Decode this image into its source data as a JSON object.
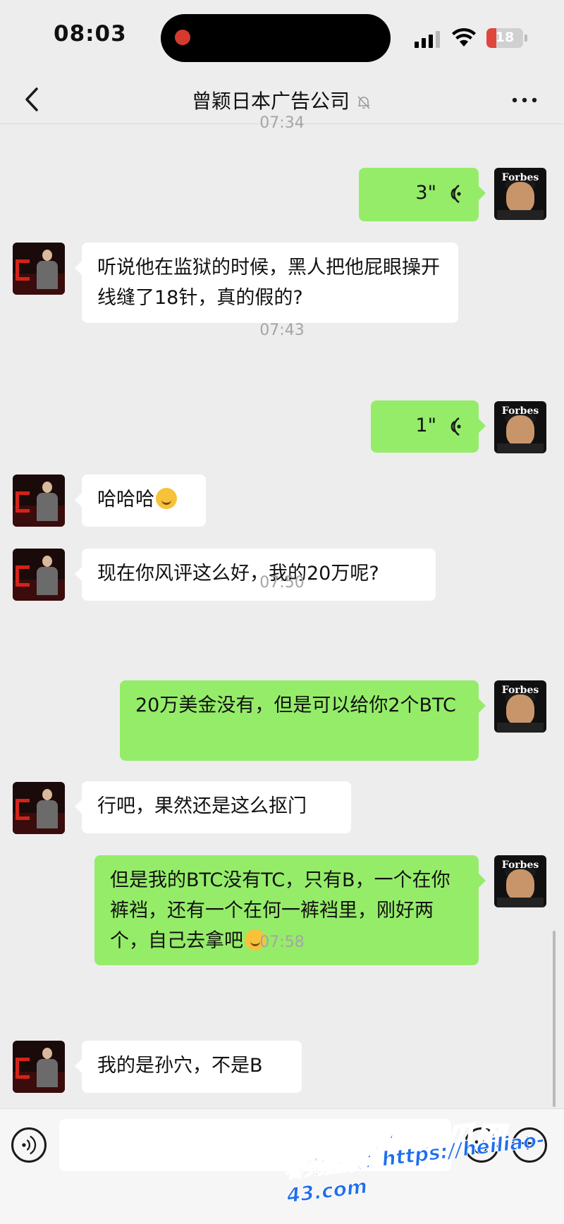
{
  "status_bar": {
    "time": "08:03",
    "battery": "18"
  },
  "nav": {
    "title": "曾颖日本广告公司"
  },
  "messages": {
    "t1": "07:34",
    "m1_duration": "3\"",
    "m2": "听说他在监狱的时候，黑人把他屁眼操开线缝了18针，真的假的?",
    "t2": "07:43",
    "m3_duration": "1\"",
    "m4": "哈哈哈",
    "m5": "现在你风评这么好，我的20万呢?",
    "t3": "07:50",
    "m6": "20万美金没有，但是可以给你2个BTC",
    "m7": "行吧，果然还是这么抠门",
    "m8": "但是我的BTC没有TC，只有B，一个在你裤裆，还有一个在何一裤裆里，刚好两个，自己去拿吧",
    "t4": "07:58",
    "m9": "我的是孙穴，不是B"
  },
  "avatars": {
    "self_caption": "Forbes"
  },
  "watermark": {
    "brand": "黑料吃瓜网",
    "line2_prefix": "看完整版：",
    "url": "https://heiliao-43.com"
  },
  "colors": {
    "background": "#ededed",
    "bubble_out": "#95ec69",
    "bubble_in": "#ffffff",
    "timestamp": "#a5a5a5"
  }
}
